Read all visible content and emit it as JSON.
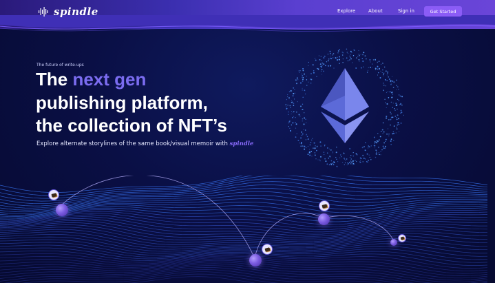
{
  "brand": {
    "name": "spindle"
  },
  "nav": {
    "links": [
      "Explore",
      "About",
      "Sign in"
    ],
    "cta": "Get Started"
  },
  "hero": {
    "eyebrow": "The future of write-ups",
    "title_line1_prefix": "The ",
    "title_line1_accent": "next gen",
    "title_line2": "publishing platform,",
    "title_line3": "the collection of NFT’s",
    "subtitle": "Explore alternate storylines of the same book/visual memoir with ",
    "subtitle_brand": "spindle"
  },
  "colors": {
    "background": "#0a0f45",
    "accent": "#7b6cf0",
    "cta": "#8b5cf6",
    "header_band": "#4a35c0"
  },
  "icons": [
    "waveform-logo-icon",
    "ethereum-icon",
    "book-icon"
  ]
}
